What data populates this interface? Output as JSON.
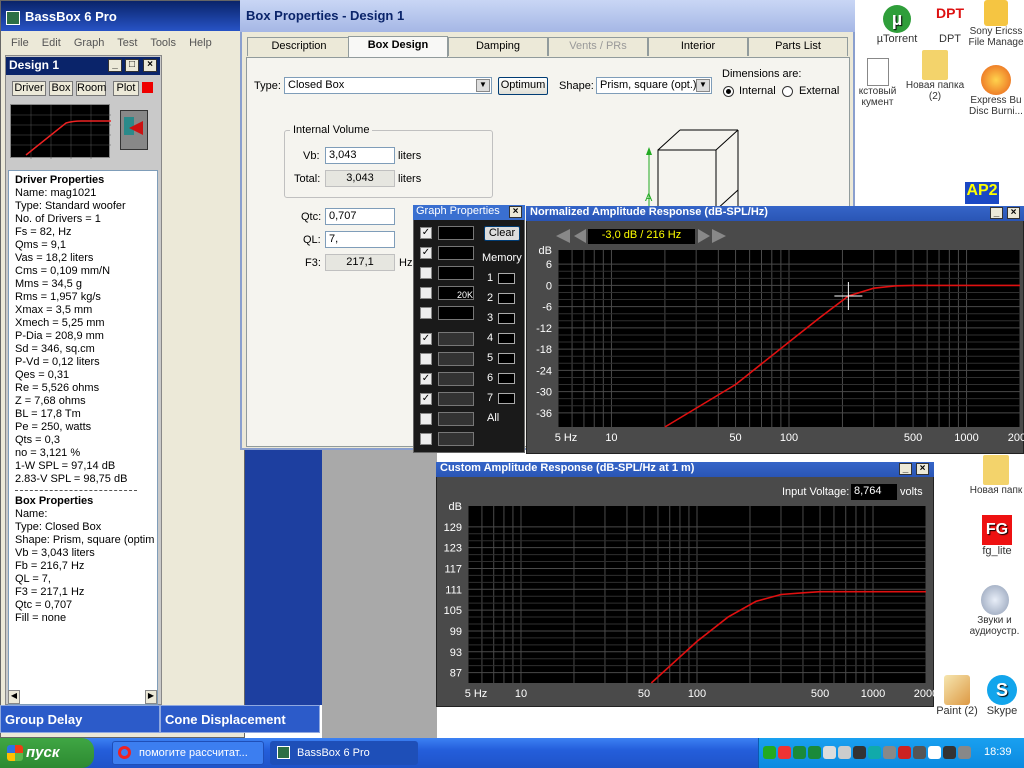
{
  "app": {
    "title": "BassBox 6 Pro",
    "menu": [
      "File",
      "Edit",
      "Graph",
      "Test",
      "Tools",
      "Help"
    ],
    "design_title": "Design 1",
    "toolbar": [
      "Driver",
      "Box",
      "Room",
      "Plot"
    ]
  },
  "driver_properties": {
    "heading": "Driver Properties",
    "lines": [
      "Name: mag1021",
      "Type: Standard woofer",
      "No. of Drivers = 1",
      "Fs = 82, Hz",
      "Qms = 9,1",
      "Vas = 18,2 liters",
      "Cms = 0,109 mm/N",
      "Mms = 34,5 g",
      "Rms = 1,957 kg/s",
      "Xmax = 3,5 mm",
      "Xmech = 5,25 mm",
      "P-Dia = 208,9 mm",
      "Sd = 346, sq.cm",
      "P-Vd = 0,12 liters",
      "Qes = 0,31",
      "Re = 5,526 ohms",
      "Z = 7,68 ohms",
      "BL = 17,8 Tm",
      "Pe = 250, watts",
      "Qts = 0,3",
      "no = 3,121 %",
      "1-W SPL = 97,14 dB",
      "2.83-V SPL = 98,75 dB"
    ]
  },
  "box_properties_list": {
    "heading": "Box Properties",
    "lines": [
      "Name:",
      "Type: Closed Box",
      "Shape: Prism, square (optim",
      "Vb = 3,043 liters",
      "Fb = 216,7 Hz",
      "QL = 7,",
      "F3 = 217,1 Hz",
      "Qtc = 0,707",
      "Fill = none"
    ]
  },
  "bottom_tabs": [
    "Group Delay",
    "Cone Displacement"
  ],
  "box_dialog": {
    "title": "Box Properties - Design 1",
    "tabs": [
      "Description",
      "Box Design",
      "Damping",
      "Vents / PRs",
      "Interior",
      "Parts List"
    ],
    "type_label": "Type:",
    "type_value": "Closed Box",
    "optimum": "Optimum",
    "shape_label": "Shape:",
    "shape_value": "Prism, square (opt.)",
    "dimensions_label": "Dimensions are:",
    "internal": "Internal",
    "external": "External",
    "internal_volume": "Internal Volume",
    "vb_label": "Vb:",
    "vb_value": "3,043",
    "total_label": "Total:",
    "total_value": "3,043",
    "liters": "liters",
    "qtc_label": "Qtc:",
    "qtc_value": "0,707",
    "ql_label": "QL:",
    "ql_value": "7,",
    "f3_label": "F3:",
    "f3_value": "217,1",
    "hz": "Hz",
    "dim_letter": "A"
  },
  "graph_properties": {
    "title": "Graph Properties",
    "clear": "Clear",
    "memory": "Memory",
    "slots": [
      "1",
      "2",
      "3",
      "4",
      "5",
      "6",
      "7",
      "All"
    ],
    "twenty_k": "20K"
  },
  "normalized_chart": {
    "title": "Normalized Amplitude Response (dB-SPL/Hz)",
    "readout": "-3,0 dB / 216 Hz",
    "ylabel": "dB",
    "y_ticks": [
      "6",
      "0",
      "-6",
      "-12",
      "-18",
      "-24",
      "-30",
      "-36"
    ],
    "x_ticks": [
      "5 Hz",
      "10",
      "50",
      "100",
      "500",
      "1000",
      "2000"
    ]
  },
  "custom_chart": {
    "title": "Custom Amplitude Response (dB-SPL/Hz at 1 m)",
    "input_voltage_label": "Input Voltage:",
    "input_voltage": "8,764",
    "volts": "volts",
    "ylabel": "dB",
    "y_ticks": [
      "129",
      "123",
      "117",
      "111",
      "105",
      "99",
      "93",
      "87"
    ],
    "x_ticks": [
      "5 Hz",
      "10",
      "50",
      "100",
      "500",
      "1000",
      "2000"
    ]
  },
  "chart_data": [
    {
      "type": "line",
      "title": "Normalized Amplitude Response (dB-SPL/Hz)",
      "ylabel": "dB",
      "xscale": "log",
      "xlim": [
        5,
        2000
      ],
      "ylim": [
        -40,
        10
      ],
      "series": [
        {
          "x": [
            20,
            50,
            100,
            150,
            216,
            300,
            400,
            500,
            1000,
            2000
          ],
          "y": [
            -40,
            -28,
            -16,
            -9,
            -3,
            -0.8,
            -0.1,
            0,
            0,
            0
          ]
        }
      ]
    },
    {
      "type": "line",
      "title": "Custom Amplitude Response (dB-SPL/Hz at 1 m)",
      "ylabel": "dB",
      "xscale": "log",
      "xlim": [
        5,
        2000
      ],
      "ylim": [
        84,
        135
      ],
      "series": [
        {
          "x": [
            55,
            100,
            150,
            216,
            300,
            400,
            500,
            1000,
            2000
          ],
          "y": [
            84,
            96,
            103,
            107.5,
            109.5,
            110,
            110.3,
            110.3,
            110.3
          ]
        }
      ]
    }
  ],
  "desktop_icons": [
    {
      "label": "µTorrent"
    },
    {
      "label": "DPT"
    },
    {
      "label": "Sony Ericss File Manage"
    },
    {
      "label": "кстовый кумент"
    },
    {
      "label": "Новая папка (2)"
    },
    {
      "label": "Express Bu Disc Burni..."
    },
    {
      "label": "Новая папк"
    },
    {
      "label": "fg_lite"
    },
    {
      "label": "Звуки и аудиоустр."
    },
    {
      "label": "Paint (2)"
    },
    {
      "label": "Skype"
    }
  ],
  "taskbar": {
    "start": "пуск",
    "tasks": [
      "помогите рассчитат...",
      "BassBox 6 Pro"
    ],
    "clock": "18:39"
  }
}
